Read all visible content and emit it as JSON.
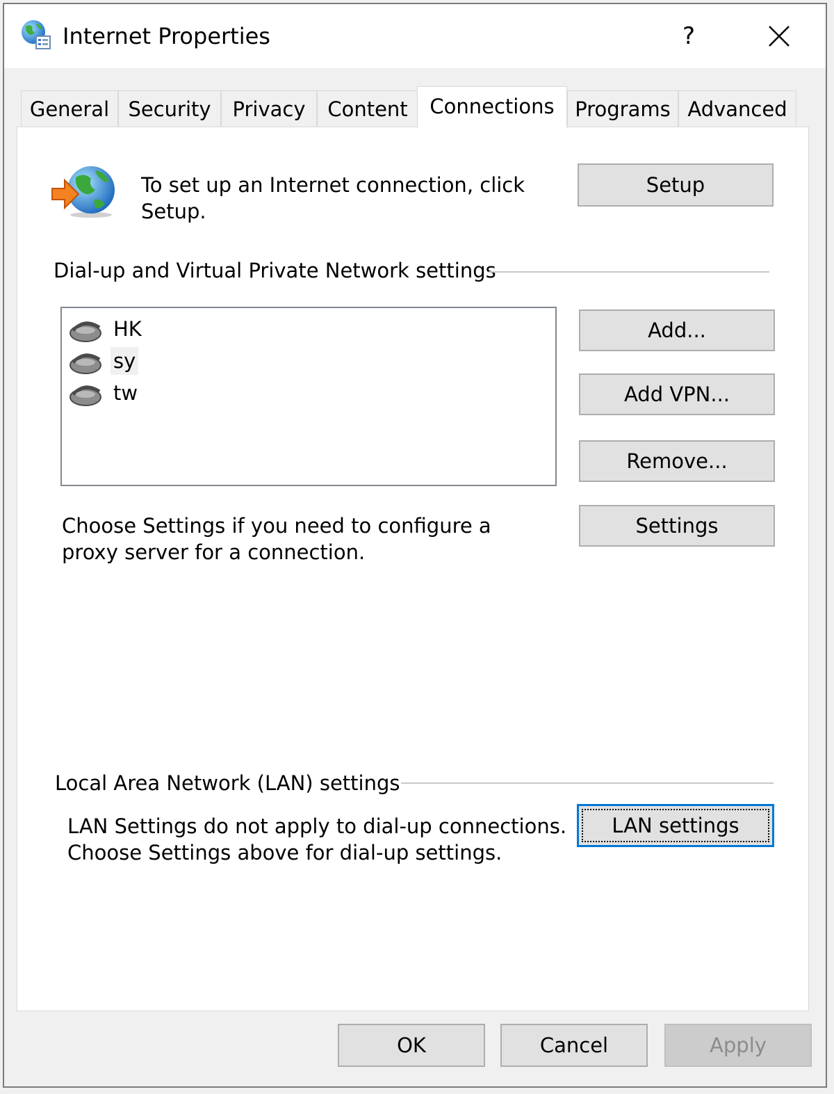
{
  "window": {
    "title": "Internet Properties",
    "help_label": "?",
    "tabs": [
      {
        "label": "General"
      },
      {
        "label": "Security"
      },
      {
        "label": "Privacy"
      },
      {
        "label": "Content"
      },
      {
        "label": "Connections",
        "active": true
      },
      {
        "label": "Programs"
      },
      {
        "label": "Advanced"
      }
    ]
  },
  "setup": {
    "description": "To set up an Internet connection, click Setup.",
    "button_label": "Setup"
  },
  "dialup": {
    "heading": "Dial-up and Virtual Private Network settings",
    "connections": [
      {
        "name": "HK"
      },
      {
        "name": "sy",
        "selected": true
      },
      {
        "name": "tw"
      }
    ],
    "add_label": "Add...",
    "add_vpn_label": "Add VPN...",
    "remove_label": "Remove...",
    "settings_label": "Settings",
    "proxy_description": "Choose Settings if you need to configure a proxy server for a connection."
  },
  "lan": {
    "heading": "Local Area Network (LAN) settings",
    "description": "LAN Settings do not apply to dial-up connections. Choose Settings above for dial-up settings.",
    "button_label": "LAN settings"
  },
  "footer": {
    "ok_label": "OK",
    "cancel_label": "Cancel",
    "apply_label": "Apply"
  },
  "colors": {
    "accent": "#0078d7",
    "button_face": "#e1e1e1",
    "window_bg": "#f0f0f0"
  }
}
